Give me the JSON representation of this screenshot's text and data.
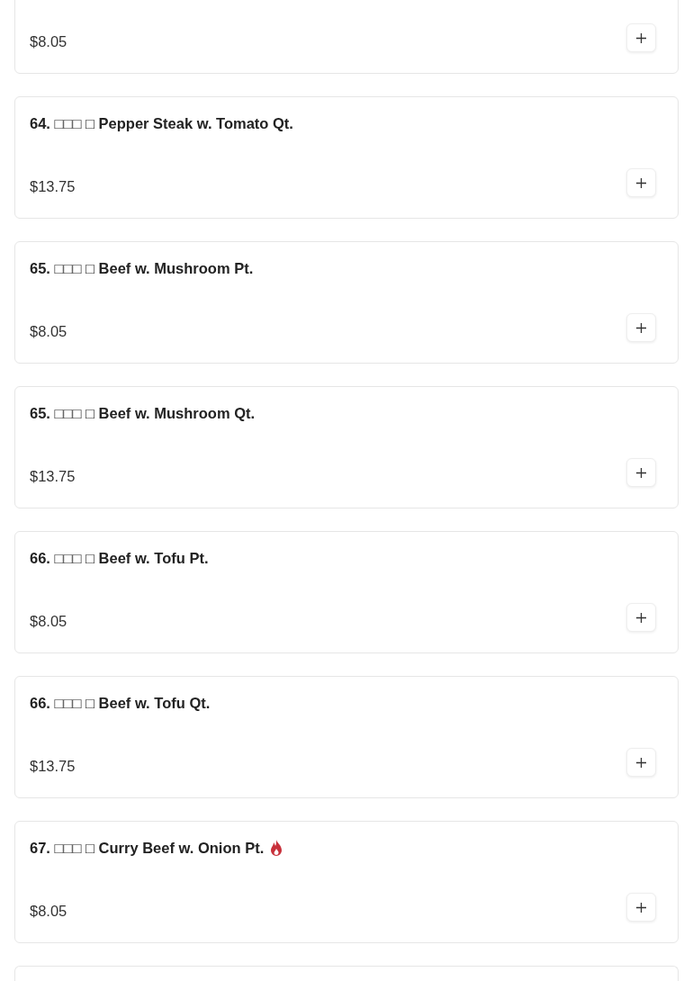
{
  "items": [
    {
      "kind": "item",
      "price": "$8.05"
    },
    {
      "kind": "item",
      "title": "64. □□□ □ Pepper Steak w. Tomato Qt.",
      "price": "$13.75",
      "spicy": false
    },
    {
      "kind": "item",
      "title": "65. □□□ □ Beef w. Mushroom Pt.",
      "price": "$8.05",
      "spicy": false
    },
    {
      "kind": "item",
      "title": "65. □□□ □ Beef w. Mushroom Qt.",
      "price": "$13.75",
      "spicy": false
    },
    {
      "kind": "item",
      "title": "66. □□□ □ Beef w. Tofu Pt.",
      "price": "$8.05",
      "spicy": false
    },
    {
      "kind": "item",
      "title": "66. □□□ □ Beef w. Tofu Qt.",
      "price": "$13.75",
      "spicy": false
    },
    {
      "kind": "item",
      "title": "67. □□□ □ Curry Beef w. Onion Pt.",
      "price": "$8.05",
      "spicy": true
    },
    {
      "kind": "cut"
    }
  ]
}
